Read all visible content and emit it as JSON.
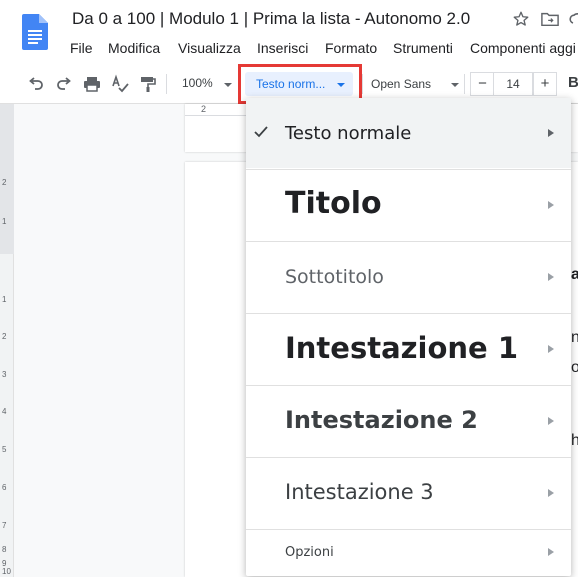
{
  "document": {
    "title": "Da 0 a 100 | Modulo 1 | Prima la lista - Autonomo 2.0"
  },
  "menu": [
    "File",
    "Modifica",
    "Visualizza",
    "Inserisci",
    "Formato",
    "Strumenti",
    "Componenti aggi"
  ],
  "toolbar": {
    "zoom": "100%",
    "style": "Testo norm...",
    "font": "Open Sans",
    "font_size": "14",
    "minus": "−",
    "plus": "+",
    "bold": "B"
  },
  "ruler": {
    "top_mark": "2",
    "left_marks": [
      "2",
      "1",
      "1",
      "2",
      "3",
      "4",
      "5",
      "6",
      "7",
      "8",
      "9",
      "10"
    ]
  },
  "page_fragments": [
    "a",
    "n",
    "o",
    "h"
  ],
  "style_menu": {
    "items": [
      {
        "label": "Testo normale",
        "selected": true
      },
      {
        "label": "Titolo",
        "selected": false
      },
      {
        "label": "Sottotitolo",
        "selected": false
      },
      {
        "label": "Intestazione 1",
        "selected": false
      },
      {
        "label": "Intestazione 2",
        "selected": false
      },
      {
        "label": "Intestazione 3",
        "selected": false
      },
      {
        "label": "Opzioni",
        "selected": false
      }
    ]
  },
  "colors": {
    "highlight_box": "#e53935",
    "accent": "#1a73e8",
    "docs_blue": "#4285f4"
  }
}
